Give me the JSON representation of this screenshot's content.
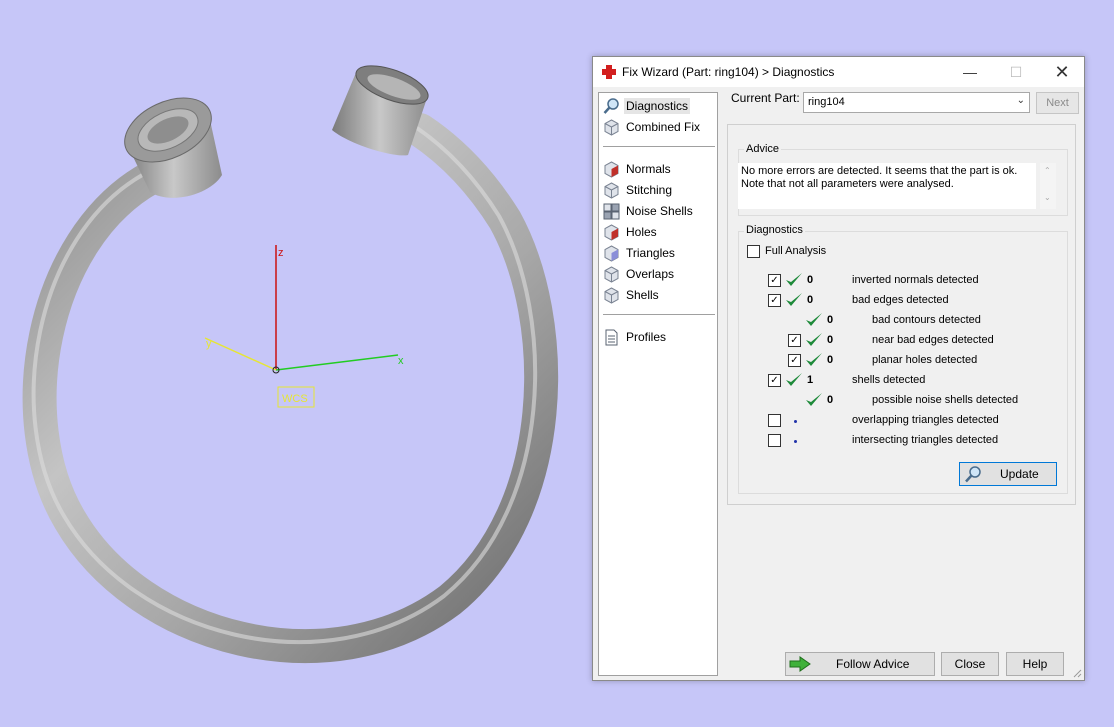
{
  "scene": {
    "axes": {
      "x_label": "x",
      "y_label": "y",
      "z_label": "z",
      "origin_label": "WCS"
    }
  },
  "dialog": {
    "title": "Fix Wizard (Part: ring104) > Diagnostics",
    "window_controls": {
      "minimize": "—",
      "maximize": "☐",
      "close": "✕"
    },
    "nav": {
      "top_items": [
        {
          "label": "Diagnostics",
          "icon": "magnifier-icon",
          "selected": true
        },
        {
          "label": "Combined Fix",
          "icon": "cube-icon"
        }
      ],
      "fix_items": [
        {
          "label": "Normals",
          "icon": "normals-cube-icon"
        },
        {
          "label": "Stitching",
          "icon": "stitching-cube-icon"
        },
        {
          "label": "Noise Shells",
          "icon": "noise-shells-icon"
        },
        {
          "label": "Holes",
          "icon": "holes-cube-icon"
        },
        {
          "label": "Triangles",
          "icon": "triangles-cube-icon"
        },
        {
          "label": "Overlaps",
          "icon": "overlaps-cube-icon"
        },
        {
          "label": "Shells",
          "icon": "shells-cube-icon"
        }
      ],
      "bottom_items": [
        {
          "label": "Profiles",
          "icon": "document-icon"
        }
      ]
    },
    "current_part_label": "Current Part:",
    "current_part_value": "ring104",
    "next_label": "Next",
    "advice": {
      "title": "Advice",
      "line1": "No more errors are detected. It seems that the part is ok.",
      "line2": "Note that not all parameters were analysed."
    },
    "diagnostics": {
      "title": "Diagnostics",
      "full_analysis_label": "Full Analysis",
      "full_analysis_checked": false,
      "rows": [
        {
          "label": "inverted normals detected",
          "count": "0",
          "checked": true
        },
        {
          "label": "bad edges detected",
          "count": "0",
          "checked": true
        },
        {
          "label": "bad contours detected",
          "count": "0"
        },
        {
          "label": "near bad edges detected",
          "count": "0",
          "checked": true
        },
        {
          "label": "planar holes detected",
          "count": "0",
          "checked": true
        },
        {
          "label": "shells detected",
          "count": "1",
          "checked": true
        },
        {
          "label": "possible noise shells detected",
          "count": "0"
        },
        {
          "label": "overlapping triangles detected",
          "checked": false
        },
        {
          "label": "intersecting triangles detected",
          "checked": false
        }
      ],
      "update_label": "Update"
    },
    "footer": {
      "follow_advice_label": "Follow Advice",
      "close_label": "Close",
      "help_label": "Help"
    },
    "colors": {
      "viewport_bg": "#c6c6f8",
      "check_green": "#1e8a3a",
      "accent_blue": "#0078d7",
      "axis_x": "#22cc22",
      "axis_y": "#e6e635",
      "axis_z": "#cc1111"
    }
  }
}
